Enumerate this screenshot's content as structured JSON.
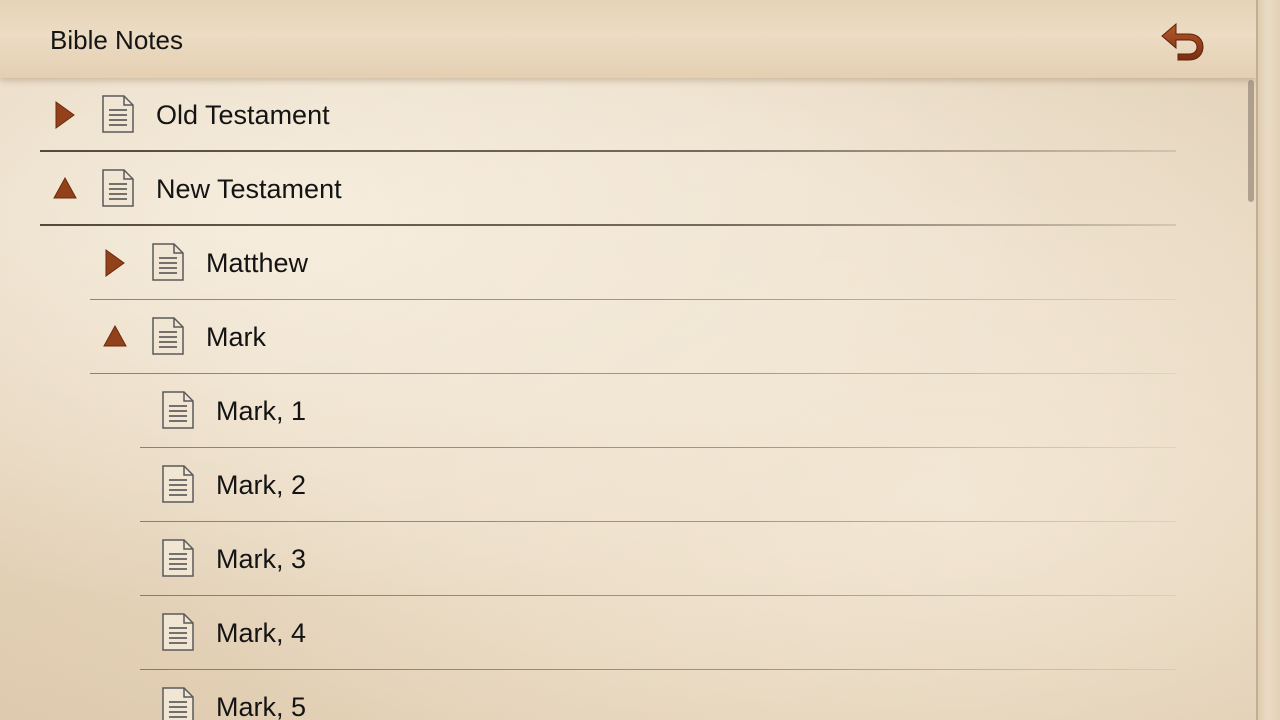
{
  "header": {
    "title": "Bible Notes",
    "back_icon": "undo-arrow-icon"
  },
  "colors": {
    "accent": "#8a3a14",
    "text": "#141414",
    "paper": "#eadbc4"
  },
  "tree": [
    {
      "label": "Old Testament",
      "level": 0,
      "expander": "collapsed"
    },
    {
      "label": "New Testament",
      "level": 0,
      "expander": "expanded"
    },
    {
      "label": "Matthew",
      "level": 1,
      "expander": "collapsed"
    },
    {
      "label": "Mark",
      "level": 1,
      "expander": "expanded"
    },
    {
      "label": "Mark, 1",
      "level": 2,
      "expander": "none"
    },
    {
      "label": "Mark, 2",
      "level": 2,
      "expander": "none"
    },
    {
      "label": "Mark, 3",
      "level": 2,
      "expander": "none"
    },
    {
      "label": "Mark, 4",
      "level": 2,
      "expander": "none"
    },
    {
      "label": "Mark, 5",
      "level": 2,
      "expander": "none"
    }
  ]
}
